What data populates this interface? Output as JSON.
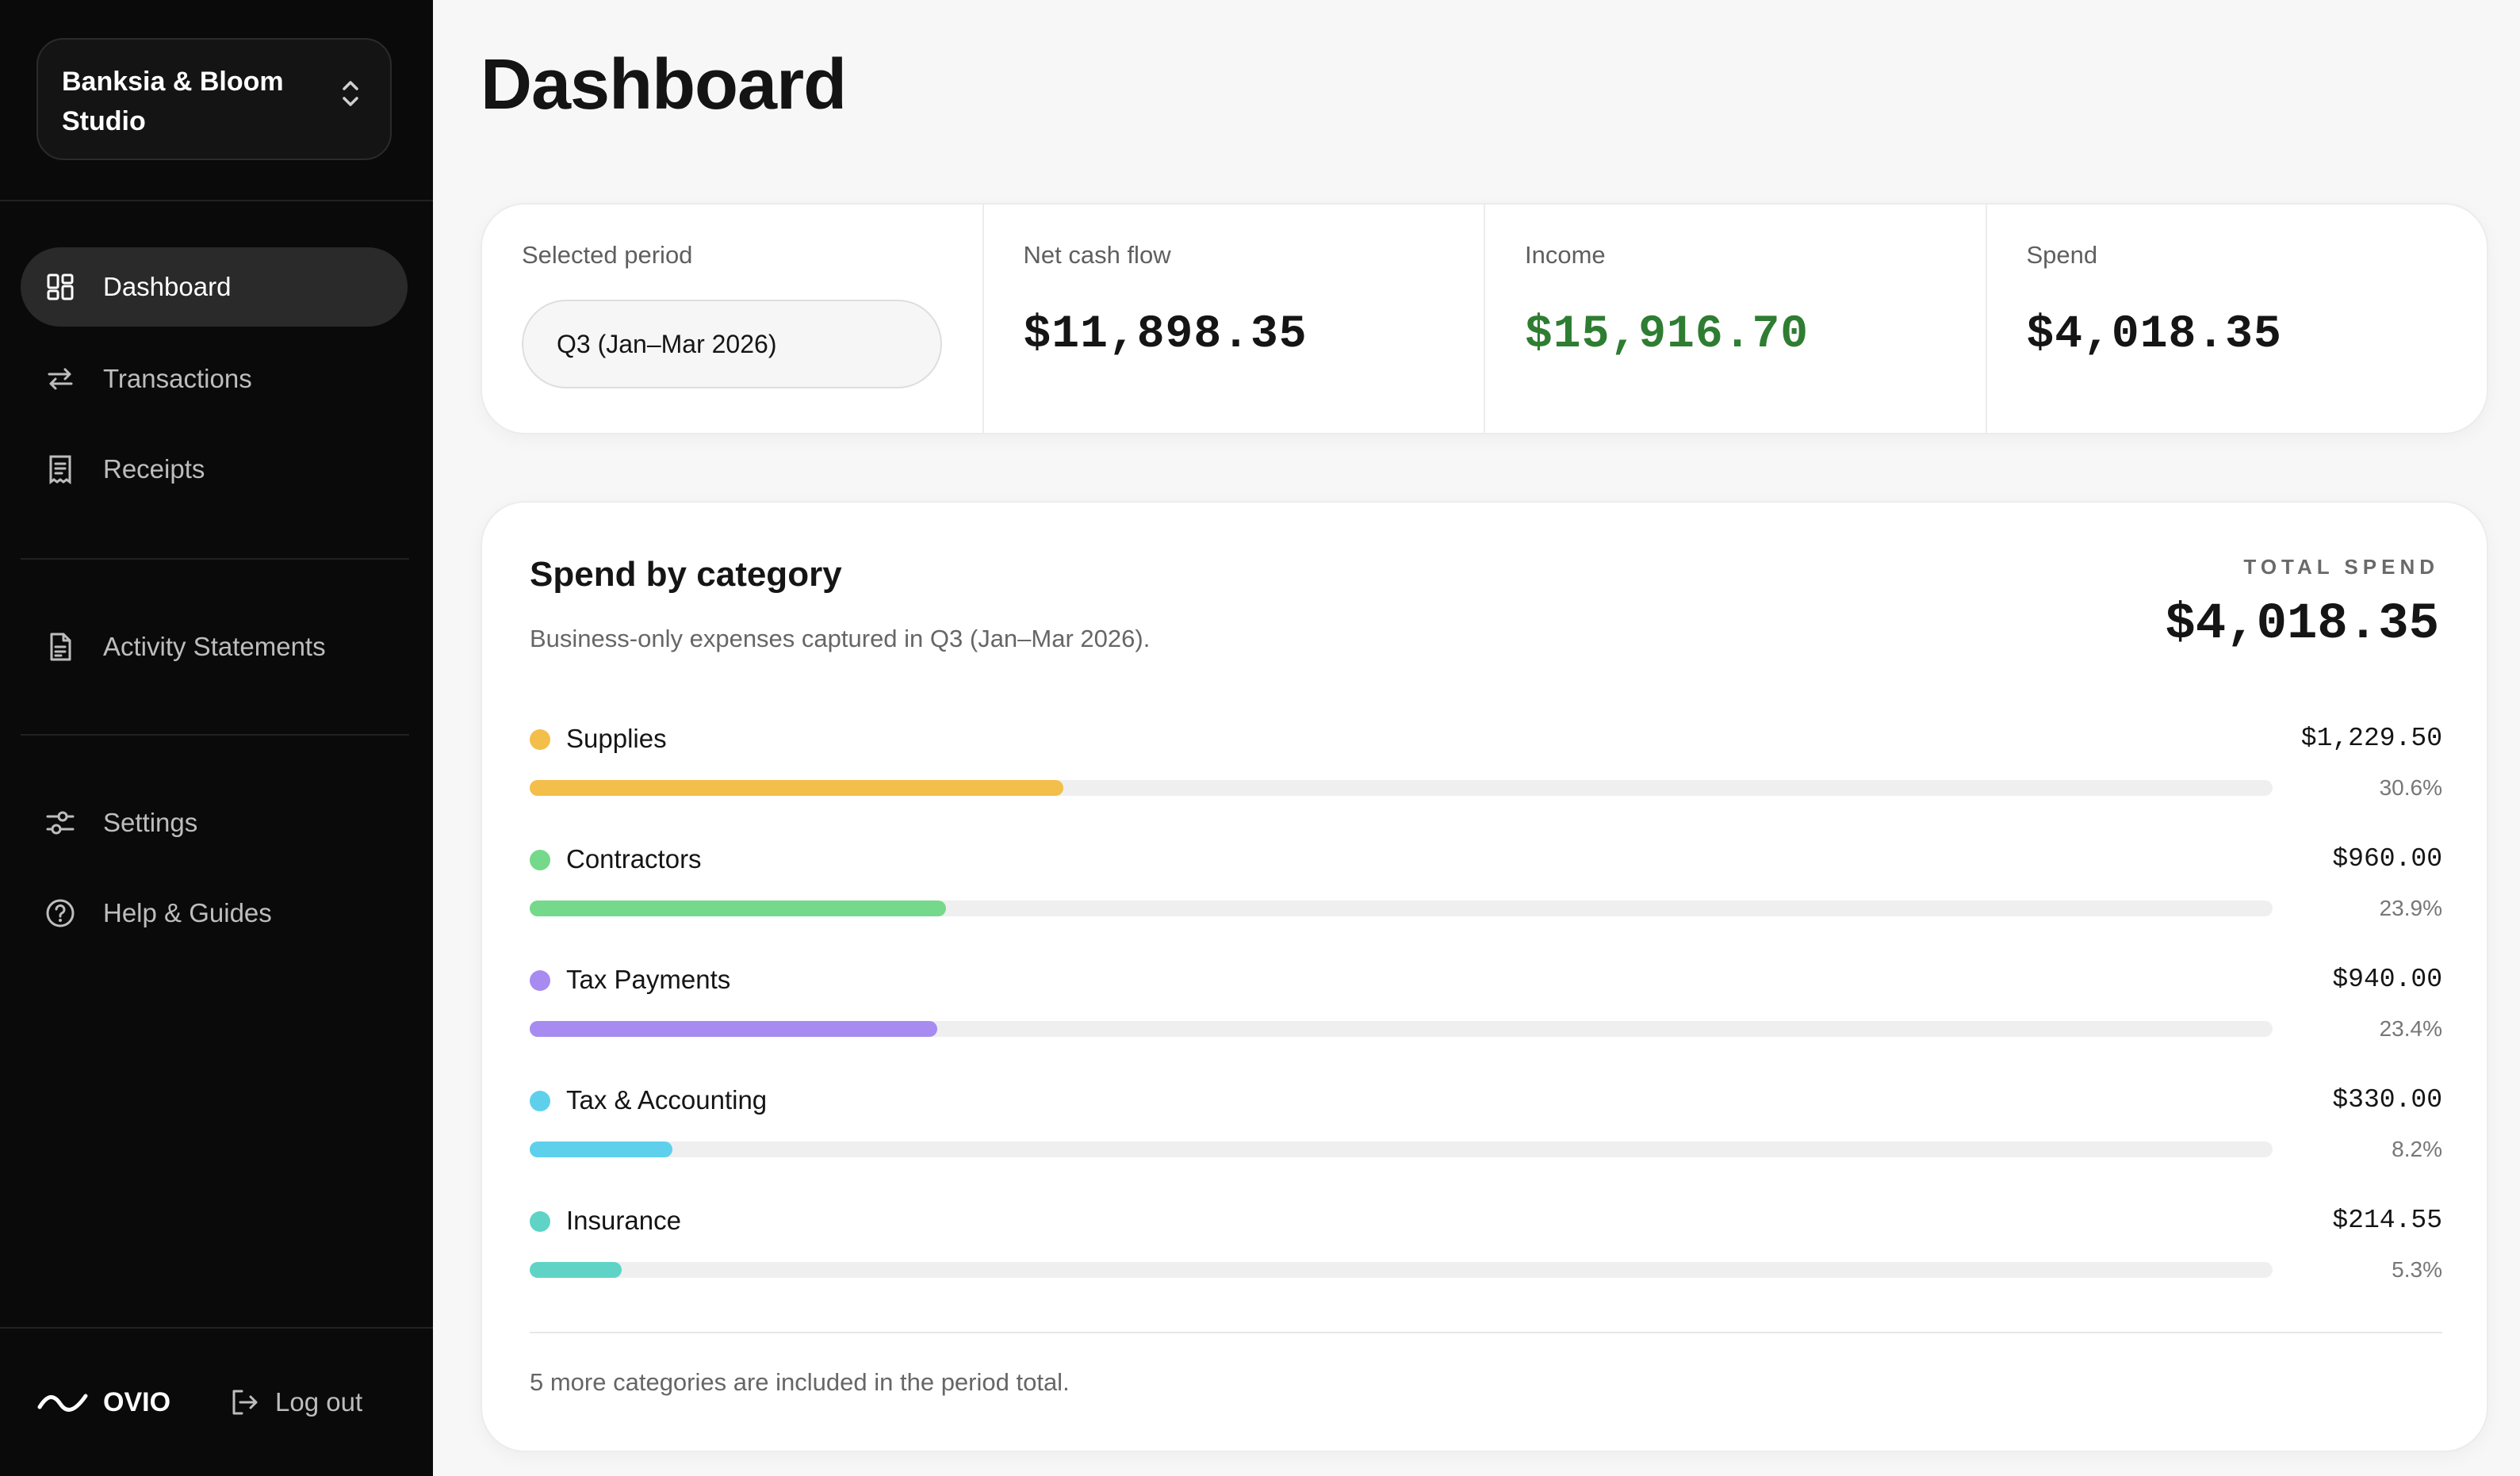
{
  "sidebar": {
    "org_name": "Banksia & Bloom Studio",
    "nav": [
      {
        "label": "Dashboard",
        "icon": "dashboard-icon",
        "active": true
      },
      {
        "label": "Transactions",
        "icon": "transactions-icon",
        "active": false
      },
      {
        "label": "Receipts",
        "icon": "receipt-icon",
        "active": false
      },
      {
        "label": "Activity Statements",
        "icon": "document-icon",
        "active": false
      },
      {
        "label": "Settings",
        "icon": "settings-icon",
        "active": false
      },
      {
        "label": "Help & Guides",
        "icon": "help-icon",
        "active": false
      }
    ],
    "brand": "OVIO",
    "logout_label": "Log out"
  },
  "page": {
    "title": "Dashboard"
  },
  "stats": {
    "period_label": "Selected period",
    "period_value": "Q3 (Jan–Mar 2026)",
    "net_label": "Net cash flow",
    "net_value": "$11,898.35",
    "income_label": "Income",
    "income_value": "$15,916.70",
    "spend_label": "Spend",
    "spend_value": "$4,018.35"
  },
  "categories": {
    "title": "Spend by category",
    "subtitle": "Business-only expenses captured in Q3 (Jan–Mar 2026).",
    "total_label": "TOTAL SPEND",
    "total_value": "$4,018.35",
    "items": [
      {
        "name": "Supplies",
        "amount": "$1,229.50",
        "pct": "30.6%",
        "fraction": 0.306,
        "color": "#f3be4a"
      },
      {
        "name": "Contractors",
        "amount": "$960.00",
        "pct": "23.9%",
        "fraction": 0.239,
        "color": "#74d98a"
      },
      {
        "name": "Tax Payments",
        "amount": "$940.00",
        "pct": "23.4%",
        "fraction": 0.234,
        "color": "#a78bf0"
      },
      {
        "name": "Tax & Accounting",
        "amount": "$330.00",
        "pct": "8.2%",
        "fraction": 0.082,
        "color": "#5fd0ec"
      },
      {
        "name": "Insurance",
        "amount": "$214.55",
        "pct": "5.3%",
        "fraction": 0.053,
        "color": "#5fd4c6"
      }
    ],
    "note": "5 more categories are included in the period total."
  },
  "colors": {
    "sidebar_bg": "#0a0a0a",
    "income_green": "#2e7d32",
    "page_bg": "#f7f7f7"
  }
}
